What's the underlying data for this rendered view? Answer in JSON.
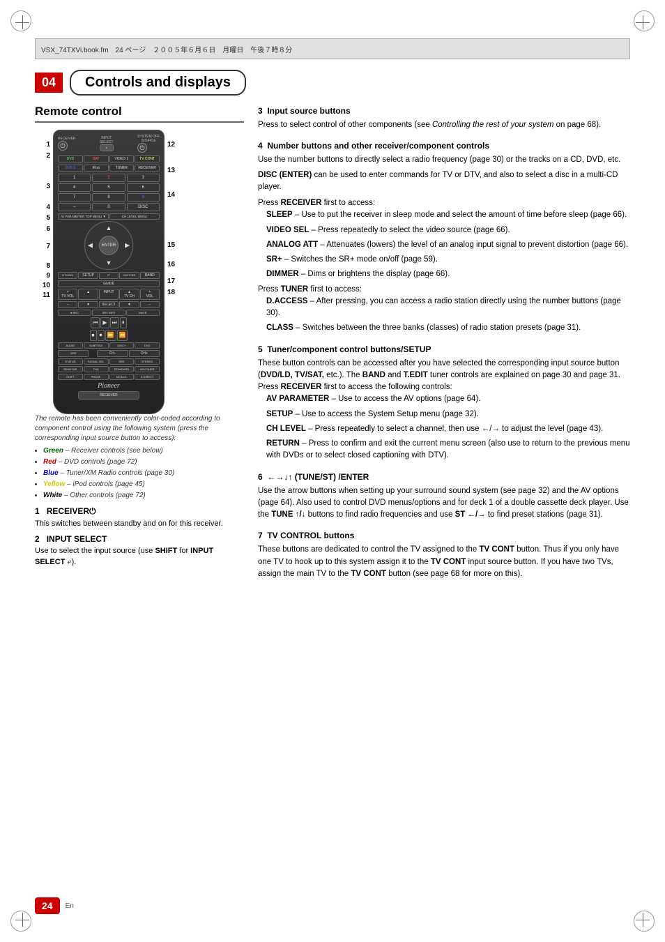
{
  "page": {
    "header_text": "VSX_74TXVi.book.fm　24 ページ　２００５年６月６日　月曜日　午後７時８分",
    "chapter_number": "04",
    "chapter_title": "Controls and displays",
    "page_number": "24",
    "page_lang": "En"
  },
  "remote_section": {
    "title": "Remote control",
    "caption": "The remote has been conveniently color-coded according to component control using the following system (press the corresponding input source button to access):",
    "color_items": [
      {
        "color": "Green",
        "text": "– Receiver controls (see below)"
      },
      {
        "color": "Red",
        "text": "– DVD controls (page 72)"
      },
      {
        "color": "Blue",
        "text": "– Tuner/XM Radio controls (page 30)"
      },
      {
        "color": "Yellow",
        "text": "– iPod controls (page 45)"
      },
      {
        "color": "White",
        "text": "– Other controls (page 72)"
      }
    ],
    "labels_left": [
      "1",
      "2",
      "",
      "3",
      "",
      "4",
      "5",
      "6",
      "",
      "7",
      "",
      "8",
      "9",
      "10",
      "11"
    ],
    "labels_right": [
      "12",
      "",
      "13",
      "",
      "14",
      "",
      "",
      "",
      "15",
      "",
      "16",
      "",
      "17",
      "",
      "18"
    ],
    "numbered_items": [
      {
        "num": "1",
        "title": "RECEIVER⏻",
        "body": "This switches between standby and on for this receiver."
      },
      {
        "num": "2",
        "title": "INPUT SELECT",
        "body": "Use to select the input source (use SHIFT for INPUT SELECT)."
      }
    ]
  },
  "right_column": {
    "sections": [
      {
        "num": "3",
        "title": "Input source buttons",
        "body": "Press to select control of other components (see Controlling the rest of your system on page 68)."
      },
      {
        "num": "4",
        "title": "Number buttons and other receiver/component controls",
        "body": "Use the number buttons to directly select a radio frequency (page 30) or the tracks on a CD, DVD, etc.",
        "sub_items": [
          {
            "term": "DISC (ENTER)",
            "def": " can be used to enter commands for TV or DTV, and also to select a disc in a multi-CD player."
          }
        ],
        "press_items": [
          {
            "press_prefix": "Press RECEIVER first to access:",
            "items": [
              {
                "term": "SLEEP",
                "def": " – Use to put the receiver in sleep mode and select the amount of time before sleep (page 66)."
              },
              {
                "term": "VIDEO SEL",
                "def": " – Press repeatedly to select the video source (page 66)."
              },
              {
                "term": "ANALOG ATT",
                "def": " – Attenuates (lowers) the level of an analog input signal to prevent distortion (page 66)."
              },
              {
                "term": "SR+",
                "def": " – Switches the SR+ mode on/off (page 59)."
              },
              {
                "term": "DIMMER",
                "def": " – Dims or brightens the display (page 66)."
              }
            ]
          },
          {
            "press_prefix": "Press TUNER first to access:",
            "items": [
              {
                "term": "D.ACCESS",
                "def": " – After pressing, you can access a radio station directly using the number buttons (page 30)."
              },
              {
                "term": "CLASS",
                "def": " – Switches between the three banks (classes) of radio station presets (page 31)."
              }
            ]
          }
        ]
      },
      {
        "num": "5",
        "title": "Tuner/component control buttons/SETUP",
        "body": "These button controls can be accessed after you have selected the corresponding input source button (DVD/LD, TV/SAT, etc.). The BAND and T.EDIT tuner controls are explained on page 30 and page 31. Press RECEIVER first to access the following controls:",
        "indent_items": [
          {
            "term": "AV PARAMETER",
            "def": " – Use to access the AV options (page 64)."
          },
          {
            "term": "SETUP",
            "def": " – Use to access the System Setup menu (page 32)."
          },
          {
            "term": "CH LEVEL",
            "def": " – Press repeatedly to select a channel, then use ←/→ to adjust the level (page 43)."
          },
          {
            "term": "RETURN",
            "def": " – Press to confirm and exit the current menu screen (also use to return to the previous menu with DVDs or to select closed captioning with DTV)."
          }
        ]
      },
      {
        "num": "6",
        "title": "←→↓↑ (TUNE/ST) /ENTER",
        "body": "Use the arrow buttons when setting up your surround sound system (see page 32) and the AV options (page 64). Also used to control DVD menus/options and for deck 1 of a double cassette deck player. Use the TUNE ↑/↓ buttons to find radio frequencies and use ST ←/→ to find preset stations (page 31)."
      },
      {
        "num": "7",
        "title": "TV CONTROL buttons",
        "body": "These buttons are dedicated to control the TV assigned to the TV CONT button. Thus if you only have one TV to hook up to this system assign it to the TV CONT input source button. If you have two TVs, assign the main TV to the TV CONT button (see page 68 for more on this)."
      }
    ]
  }
}
